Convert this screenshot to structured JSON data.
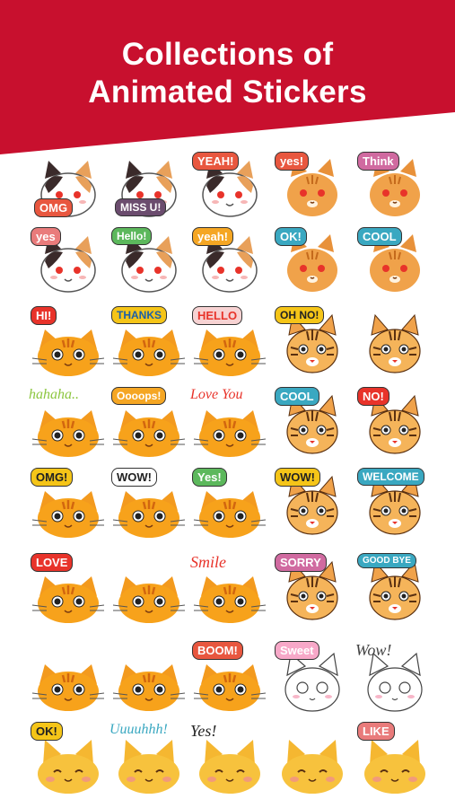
{
  "header": {
    "title_line1": "Collections of",
    "title_line2": "Animated Stickers",
    "background_color": "#c8102e"
  },
  "stickers": [
    {
      "name": "calico-omg",
      "cat": "calico",
      "label": "OMG",
      "bubble": "#e8573f",
      "text_color": "#ffffff"
    },
    {
      "name": "calico-miss-u",
      "cat": "calico",
      "label": "MISS U!",
      "bubble": "#6b4c6e",
      "text_color": "#ffffff"
    },
    {
      "name": "calico-yeah",
      "cat": "calico",
      "label": "YEAH!",
      "bubble": "#e8573f",
      "text_color": "#ffffff"
    },
    {
      "name": "tabby-yes",
      "cat": "orange-tabby",
      "label": "yes!",
      "bubble": "#e8573f",
      "text_color": "#ffffff"
    },
    {
      "name": "tabby-think",
      "cat": "orange-tabby",
      "label": "Think",
      "bubble": "#d06aa0",
      "text_color": "#ffffff"
    },
    {
      "name": "calico-yes",
      "cat": "calico",
      "label": "yes",
      "bubble": "#e97b7b",
      "text_color": "#ffffff"
    },
    {
      "name": "calico-hello",
      "cat": "calico",
      "label": "Hello!",
      "bubble": "#5cb85c",
      "text_color": "#ffffff"
    },
    {
      "name": "calico-yeah-lower",
      "cat": "calico",
      "label": "yeah!",
      "bubble": "#f5a623",
      "text_color": "#ffffff"
    },
    {
      "name": "tabby-ok",
      "cat": "orange-tabby",
      "label": "OK!",
      "bubble": "#3aa8c1",
      "text_color": "#ffffff"
    },
    {
      "name": "tabby-cool",
      "cat": "orange-tabby",
      "label": "COOL",
      "bubble": "#3aa8c1",
      "text_color": "#ffffff"
    },
    {
      "name": "orange-hi",
      "cat": "orange-round",
      "label": "HI!",
      "bubble": "#e8332a",
      "text_color": "#ffffff"
    },
    {
      "name": "orange-thanks",
      "cat": "orange-round",
      "label": "THANKS",
      "bubble": "#f5c518",
      "text_color": "#1b5fa8"
    },
    {
      "name": "orange-hello",
      "cat": "orange-round",
      "label": "HELLO",
      "bubble": "#f7d2d2",
      "text_color": "#e8332a"
    },
    {
      "name": "tabby-oh-no",
      "cat": "striped",
      "label": "OH NO!",
      "bubble": "#f5c518",
      "text_color": "#222222"
    },
    {
      "name": "tabby-tongue",
      "cat": "striped",
      "label": "",
      "bubble": "",
      "text_color": ""
    },
    {
      "name": "orange-hahaha",
      "cat": "orange-round",
      "label": "hahaha..",
      "bubble": "",
      "text_color": "#8cc63f"
    },
    {
      "name": "orange-oooops",
      "cat": "orange-round",
      "label": "Oooops!",
      "bubble": "#f5a623",
      "text_color": "#ffffff"
    },
    {
      "name": "orange-love-you",
      "cat": "orange-round",
      "label": "Love You",
      "bubble": "",
      "text_color": "#e8332a"
    },
    {
      "name": "tabby-cool-2",
      "cat": "striped",
      "label": "COOL",
      "bubble": "#3aa8c1",
      "text_color": "#ffffff"
    },
    {
      "name": "tabby-no",
      "cat": "striped",
      "label": "NO!",
      "bubble": "#e8332a",
      "text_color": "#ffffff"
    },
    {
      "name": "orange-omg",
      "cat": "orange-round",
      "label": "OMG!",
      "bubble": "#f5c518",
      "text_color": "#222222"
    },
    {
      "name": "orange-wow",
      "cat": "orange-round",
      "label": "WOW!",
      "bubble": "#ffffff",
      "text_color": "#222222"
    },
    {
      "name": "orange-yes",
      "cat": "orange-round",
      "label": "Yes!",
      "bubble": "#5cb85c",
      "text_color": "#ffffff"
    },
    {
      "name": "tabby-wow",
      "cat": "striped",
      "label": "WOW!",
      "bubble": "#f5c518",
      "text_color": "#222222"
    },
    {
      "name": "tabby-welcome",
      "cat": "striped",
      "label": "WELCOME",
      "bubble": "#3aa8c1",
      "text_color": "#ffffff"
    },
    {
      "name": "orange-love",
      "cat": "orange-round",
      "label": "LOVE",
      "bubble": "#e8332a",
      "text_color": "#ffffff"
    },
    {
      "name": "orange-plain",
      "cat": "orange-round",
      "label": "",
      "bubble": "",
      "text_color": ""
    },
    {
      "name": "orange-smile",
      "cat": "orange-round",
      "label": "Smile",
      "bubble": "",
      "text_color": "#e8332a"
    },
    {
      "name": "tabby-sorry",
      "cat": "striped",
      "label": "SORRY",
      "bubble": "#d06aa0",
      "text_color": "#ffffff"
    },
    {
      "name": "tabby-good-bye",
      "cat": "striped",
      "label": "GOOD BYE",
      "bubble": "#3aa8c1",
      "text_color": "#ffffff"
    },
    {
      "name": "orange-sleepy",
      "cat": "orange-round",
      "label": "",
      "bubble": "",
      "text_color": ""
    },
    {
      "name": "orange-grumpy",
      "cat": "orange-round",
      "label": "",
      "bubble": "",
      "text_color": ""
    },
    {
      "name": "orange-boom",
      "cat": "orange-round",
      "label": "BOOM!",
      "bubble": "#e8573f",
      "text_color": "#ffffff"
    },
    {
      "name": "white-sweet",
      "cat": "white",
      "label": "Sweet",
      "bubble": "#f7a8c8",
      "text_color": "#ffffff"
    },
    {
      "name": "white-wow",
      "cat": "white",
      "label": "Wow!",
      "bubble": "",
      "text_color": "#444444"
    },
    {
      "name": "yellow-ok",
      "cat": "yellow",
      "label": "OK!",
      "bubble": "#f5c518",
      "text_color": "#222222"
    },
    {
      "name": "yellow-uuuuhhh",
      "cat": "yellow",
      "label": "Uuuuhhh!",
      "bubble": "",
      "text_color": "#3aa8c1"
    },
    {
      "name": "yellow-yes",
      "cat": "yellow",
      "label": "Yes!",
      "bubble": "",
      "text_color": "#222222"
    },
    {
      "name": "yellow-heart-eyes",
      "cat": "yellow",
      "label": "",
      "bubble": "",
      "text_color": ""
    },
    {
      "name": "yellow-like",
      "cat": "yellow",
      "label": "LIKE",
      "bubble": "#e97b7b",
      "text_color": "#ffffff"
    }
  ]
}
